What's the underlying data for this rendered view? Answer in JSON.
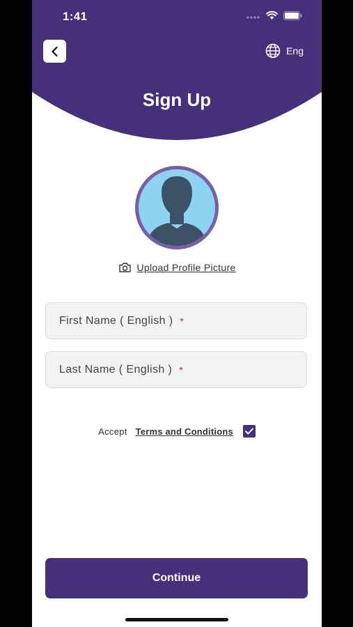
{
  "status_bar": {
    "time": "1:41"
  },
  "header": {
    "title": "Sign Up",
    "language_label": "Eng"
  },
  "profile": {
    "upload_label": "Upload Profile Picture"
  },
  "form": {
    "first_name_placeholder": "First Name ( English )",
    "last_name_placeholder": "Last Name ( English )",
    "required_mark": "*"
  },
  "terms": {
    "accept_label": "Accept",
    "link_label": "Terms and Conditions",
    "checked": true
  },
  "actions": {
    "continue_label": "Continue"
  },
  "colors": {
    "brand": "#463079",
    "avatar_ring": "#7b5fa6",
    "avatar_bg": "#8ed3f2",
    "avatar_figure": "#3d5166",
    "required": "#d21f3c"
  },
  "icons": {
    "back": "chevron-left-icon",
    "language": "globe-icon",
    "upload": "camera-icon",
    "checkbox": "checkmark-icon"
  }
}
